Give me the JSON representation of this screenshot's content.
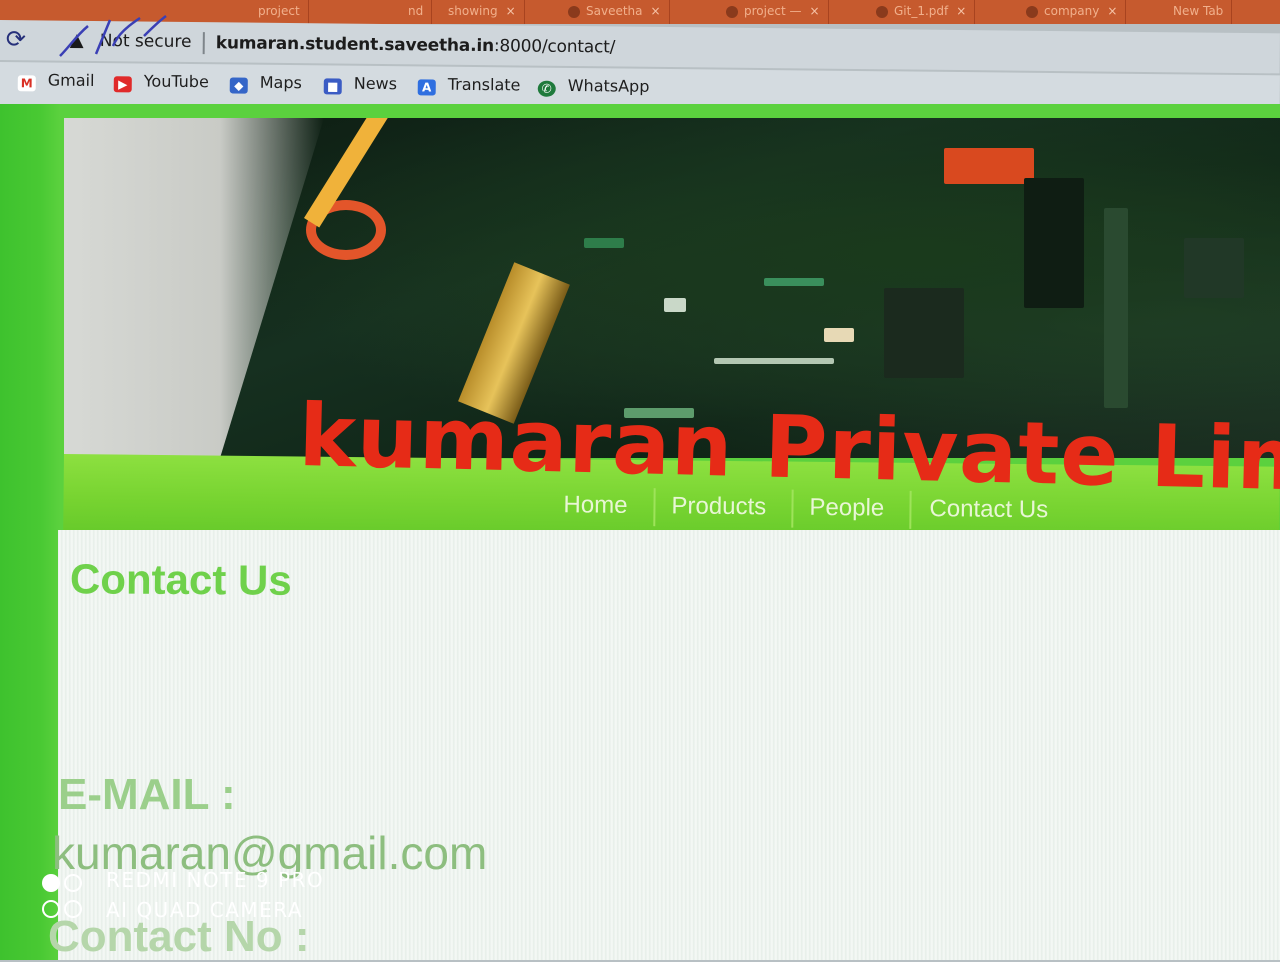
{
  "browser": {
    "tabs": [
      {
        "label": "project"
      },
      {
        "label": "nd"
      },
      {
        "label": "showing"
      },
      {
        "label": "Saveetha"
      },
      {
        "label": "project —"
      },
      {
        "label": "Git_1.pdf"
      },
      {
        "label": "company"
      },
      {
        "label": "New Tab"
      }
    ],
    "tab_close_glyph": "×",
    "security_label": "Not secure",
    "url_host": "kumaran.student.saveetha.in",
    "url_path": ":8000/contact/",
    "bookmarks": [
      {
        "label": "Gmail",
        "icon": "gmail-icon",
        "glyph": "M",
        "color": "#d93025"
      },
      {
        "label": "YouTube",
        "icon": "youtube-icon",
        "glyph": "▶",
        "color": "#e02a2a"
      },
      {
        "label": "Maps",
        "icon": "maps-icon",
        "glyph": "◆",
        "color": "#3566c8"
      },
      {
        "label": "News",
        "icon": "news-icon",
        "glyph": "■",
        "color": "#3b5cc4"
      },
      {
        "label": "Translate",
        "icon": "translate-icon",
        "glyph": "A",
        "color": "#2f6fe0"
      },
      {
        "label": "WhatsApp",
        "icon": "whatsapp-icon",
        "glyph": "✆",
        "color": "#1f7a3c"
      }
    ]
  },
  "site": {
    "brand_title": "kumaran Private Limited",
    "nav": [
      {
        "label": "Home"
      },
      {
        "label": "Products"
      },
      {
        "label": "People"
      },
      {
        "label": "Contact Us"
      }
    ],
    "section_title": "Contact Us",
    "email_label": "E-MAIL :",
    "email_value": "kumaran@gmail.com",
    "contact_label": "Contact No :"
  },
  "camera_watermark": {
    "line1": "REDMI NOTE 9 PRO",
    "line2": "AI QUAD CAMERA"
  },
  "colors": {
    "page_green": "#49c933",
    "nav_green": "#78d431",
    "brand_red": "#e62b17",
    "heading_green": "#6fd14b"
  }
}
